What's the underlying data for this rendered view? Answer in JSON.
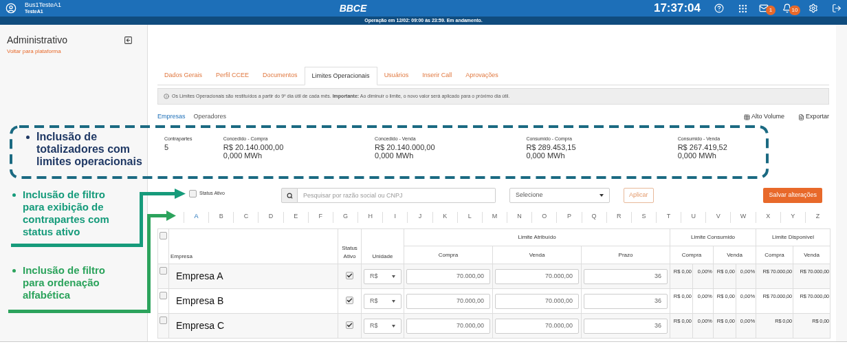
{
  "header": {
    "user_name": "Bus1TesteA1",
    "user_sub": "TesteA1",
    "logo": "BBCE",
    "clock": "17:37:04",
    "mail_badge": "1",
    "bell_badge": "10"
  },
  "notice": "Operação em 12/02: 09:00 às 23:59. Em andamento.",
  "sidebar": {
    "title": "Administrativo",
    "link": "Voltar para plataforma"
  },
  "tabs": [
    {
      "label": "Dados Gerais",
      "selected": false
    },
    {
      "label": "Perfil CCEE",
      "selected": false
    },
    {
      "label": "Documentos",
      "selected": false
    },
    {
      "label": "Limites Operacionais",
      "selected": true
    },
    {
      "label": "Usuários",
      "selected": false
    },
    {
      "label": "Inserir Call",
      "selected": false
    },
    {
      "label": "Aprovações",
      "selected": false
    }
  ],
  "info": "Os Limites Operacionais são restituídos a partir do 9º dia útil de cada mês. **Importante:** Ao diminuir o limite, o novo valor será aplicado para o próximo dia útil.",
  "subtabs": [
    {
      "label": "Empresas",
      "selected": true
    },
    {
      "label": "Operadores",
      "selected": false
    }
  ],
  "actions": [
    "Alto Volume",
    "Exportar"
  ],
  "totals": [
    {
      "label": "Contrapartes",
      "value": "5"
    },
    {
      "label": "Concedido - Compra",
      "value": "R$ 20.140.000,00",
      "mwh": "0,000 MWh"
    },
    {
      "label": "Concedido - Venda",
      "value": "R$ 20.140.000,00",
      "mwh": "0,000 MWh"
    },
    {
      "label": "Consumido - Compra",
      "value": "R$ 289.453,15",
      "mwh": "0,000 MWh"
    },
    {
      "label": "Consumido - Venda",
      "value": "R$ 267.419,52",
      "mwh": "0,000 MWh"
    }
  ],
  "filters": {
    "status_label": "Status Ativo",
    "status_checked": false,
    "search_placeholder": "Pesquisar por razão social ou CNPJ",
    "select": "Selecione",
    "apply": "Aplicar",
    "save": "Salvar alterações"
  },
  "letters": [
    {
      "label": "A",
      "selected": true
    },
    {
      "label": "B",
      "selected": false
    },
    {
      "label": "C",
      "selected": false
    },
    {
      "label": "D",
      "selected": false
    },
    {
      "label": "E",
      "selected": false
    },
    {
      "label": "F",
      "selected": false
    },
    {
      "label": "G",
      "selected": false
    },
    {
      "label": "H",
      "selected": false
    },
    {
      "label": "I",
      "selected": false
    },
    {
      "label": "J",
      "selected": false
    },
    {
      "label": "K",
      "selected": false
    },
    {
      "label": "L",
      "selected": false
    },
    {
      "label": "M",
      "selected": false
    },
    {
      "label": "N",
      "selected": false
    },
    {
      "label": "O",
      "selected": false
    },
    {
      "label": "P",
      "selected": false
    },
    {
      "label": "Q",
      "selected": false
    },
    {
      "label": "R",
      "selected": false
    },
    {
      "label": "S",
      "selected": false
    },
    {
      "label": "T",
      "selected": false
    },
    {
      "label": "U",
      "selected": false
    },
    {
      "label": "V",
      "selected": false
    },
    {
      "label": "W",
      "selected": false
    },
    {
      "label": "X",
      "selected": false
    },
    {
      "label": "Y",
      "selected": false
    },
    {
      "label": "Z",
      "selected": false
    }
  ],
  "table": {
    "select_all_checked": false,
    "columns": [
      "Empresa",
      "Status Ativo",
      "Unidade"
    ],
    "groups": [
      {
        "label": "Limite Atribuído",
        "kind": "single",
        "columns": [
          "Compra",
          "Venda",
          "Prazo"
        ]
      },
      {
        "label": "Limite Consumido",
        "kind": "split",
        "columns": [
          "Compra",
          "Venda"
        ]
      },
      {
        "label": "Limite Disponível",
        "kind": "single",
        "columns": [
          "Compra",
          "Venda"
        ]
      }
    ],
    "rows": [
      {
        "checked": false,
        "name": "Empresa A",
        "active": true,
        "unit": "R$",
        "inputs": [
          "70.000,00",
          "70.000,00",
          "36"
        ],
        "consumed": [
          "R$ 0,00",
          "0,00%",
          "R$ 0,00",
          "0,00%"
        ],
        "available": [
          "R$ 70.000,00",
          "R$ 70.000,00"
        ]
      },
      {
        "checked": false,
        "name": "Empresa B",
        "active": true,
        "unit": "R$",
        "inputs": [
          "70.000,00",
          "70.000,00",
          "36"
        ],
        "consumed": [
          "R$ 0,00",
          "0,00%",
          "R$ 0,00",
          "0,00%"
        ],
        "available": [
          "R$ 70.000,00",
          "R$ 70.000,00"
        ]
      },
      {
        "checked": false,
        "name": "Empresa C",
        "active": true,
        "unit": "R$",
        "inputs": [
          "70.000,00",
          "70.000,00",
          "36"
        ],
        "consumed": [
          "R$ 0,00",
          "0,00%",
          "R$ 0,00",
          "0,00%"
        ],
        "available": [
          "R$ 0,00",
          "R$ 0,00"
        ]
      }
    ]
  },
  "annotations": [
    {
      "text": "Inclusão de totalizadores com limites operacionais",
      "color": "#1f3864"
    },
    {
      "text": "Inclusão de filtro para exibição de contrapartes com status ativo",
      "color": "#169b7b"
    },
    {
      "text": "Inclusão de filtro para ordenação alfabética",
      "color": "#2ca35c"
    }
  ]
}
